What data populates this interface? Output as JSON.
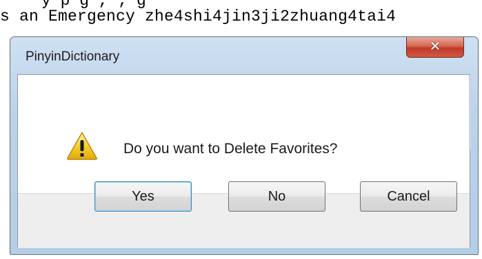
{
  "background": {
    "line_top": "s an Emergency zhe4shi4jin3ji2zhuang4tai4",
    "line_cut": "y p g , ; g"
  },
  "dialog": {
    "title": "PinyinDictionary",
    "close_icon": "close-icon",
    "message": "Do you want to Delete Favorites?",
    "icon": "warning-icon",
    "buttons": {
      "yes": "Yes",
      "no": "No",
      "cancel": "Cancel"
    }
  },
  "colors": {
    "frame": "#bcd2ea",
    "close_button": "#c0382a",
    "button_area": "#eeeeee",
    "warning_yellow": "#f2c21b"
  }
}
